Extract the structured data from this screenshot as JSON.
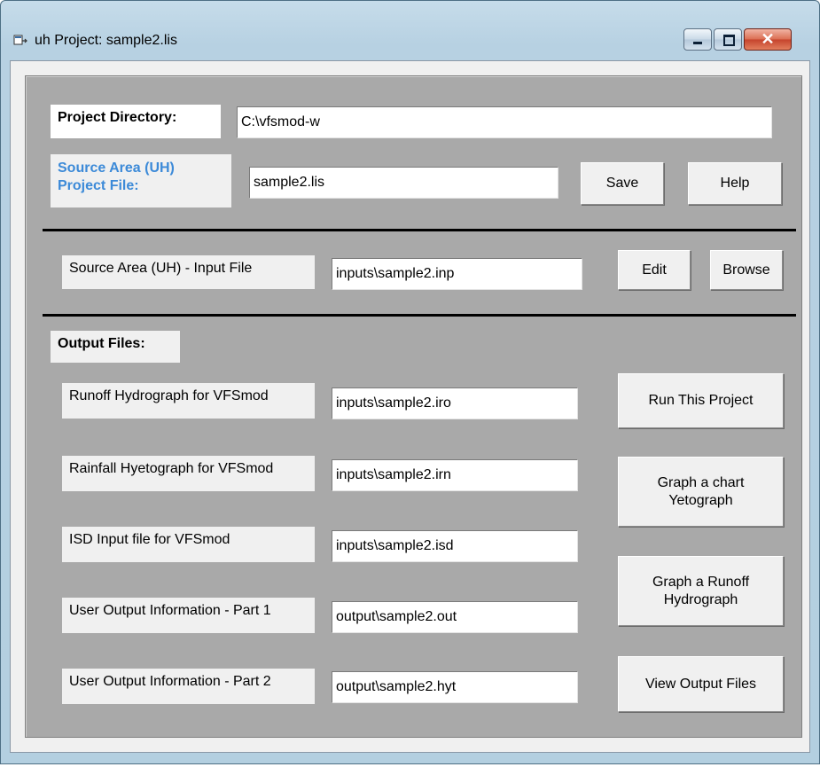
{
  "window": {
    "title": "uh Project: sample2.lis",
    "close_glyph": "✕"
  },
  "project": {
    "directory_label": "Project Directory:",
    "directory_value": "C:\\vfsmod-w",
    "file_label": "Source Area (UH) Project File:",
    "file_value": "sample2.lis",
    "save_label": "Save",
    "help_label": "Help"
  },
  "input": {
    "label": "Source Area (UH) - Input File",
    "value": "inputs\\sample2.inp",
    "edit_label": "Edit",
    "browse_label": "Browse"
  },
  "outputs": {
    "heading": "Output Files:",
    "rows": [
      {
        "label": "Runoff Hydrograph for VFSmod",
        "value": "inputs\\sample2.iro"
      },
      {
        "label": "Rainfall Hyetograph for VFSmod",
        "value": "inputs\\sample2.irn"
      },
      {
        "label": "ISD Input file for VFSmod",
        "value": "inputs\\sample2.isd"
      },
      {
        "label": "User Output Information - Part 1",
        "value": "output\\sample2.out"
      },
      {
        "label": "User Output Information - Part 2",
        "value": "output\\sample2.hyt"
      }
    ],
    "buttons": {
      "run": "Run This Project",
      "yetograph_line1": "Graph a chart",
      "yetograph_line2": "Yetograph",
      "runoff_line1": "Graph a Runoff",
      "runoff_line2": "Hydrograph",
      "view": "View Output Files"
    }
  }
}
